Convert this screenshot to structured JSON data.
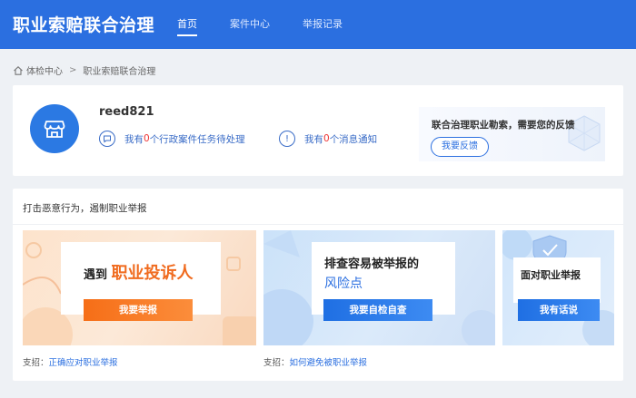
{
  "header": {
    "brand": "职业索赔联合治理",
    "nav": [
      {
        "label": "首页",
        "active": true
      },
      {
        "label": "案件中心",
        "active": false
      },
      {
        "label": "举报记录",
        "active": false
      }
    ]
  },
  "breadcrumb": {
    "home": "体检中心",
    "separator": ">",
    "current": "职业索赔联合治理"
  },
  "profile": {
    "username": "reed821",
    "task_prefix": "我有",
    "task_count": "0",
    "task_suffix": "个行政案件任务待处理",
    "msg_prefix": "我有",
    "msg_count": "0",
    "msg_suffix": "个消息通知",
    "feedback_text": "联合治理职业勒索，需要您的反馈",
    "feedback_button": "我要反馈"
  },
  "report": {
    "title": "打击恶意行为，遏制职业举报",
    "panels": [
      {
        "title_prefix": "遇到",
        "title_main": "职业投诉人",
        "button": "我要举报"
      },
      {
        "title_line1": "排查容易被举报的",
        "title_line2": "风险点",
        "button": "我要自检自查"
      },
      {
        "title": "面对职业举报",
        "button": "我有话说"
      }
    ],
    "support1_label": "支招：",
    "support1_link": "正确应对职业举报",
    "support2_label": "支招：",
    "support2_link": "如何避免被职业举报"
  },
  "colors": {
    "header_bg": "#2b6fe0",
    "accent_orange": "#f66e17",
    "accent_blue": "#1f6fe3",
    "count_red": "#e33333"
  }
}
